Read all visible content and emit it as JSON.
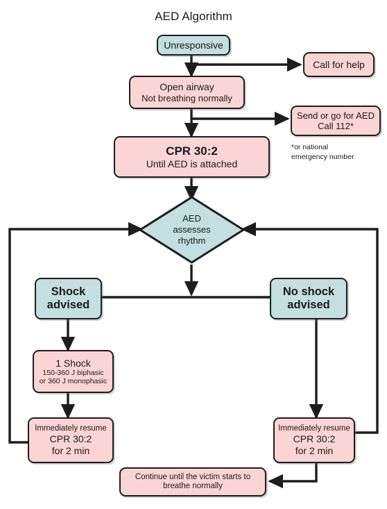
{
  "title": "AED Algorithm",
  "colors": {
    "pink": "#fbd4d5",
    "teal": "#c3dfdf",
    "stroke": "#1d1d1d",
    "background": "#ffffff",
    "text": "#1a1a1a"
  },
  "nodes": {
    "unresponsive": {
      "label": "Unresponsive",
      "shape": "rounded-rect",
      "fill": "teal"
    },
    "call_for_help": {
      "label": "Call for help",
      "shape": "rounded-rect",
      "fill": "pink"
    },
    "open_airway": {
      "line1": "Open airway",
      "line2": "Not breathing normally",
      "shape": "rounded-rect",
      "fill": "pink"
    },
    "send_for_aed": {
      "line1": "Send or go for AED",
      "line2": "Call 112*",
      "shape": "rounded-rect",
      "fill": "pink"
    },
    "cpr_initial": {
      "line1": "CPR 30:2",
      "line2": "Until AED is attached",
      "shape": "rounded-rect",
      "fill": "pink"
    },
    "aed_assesses": {
      "line1": "AED",
      "line2": "assesses",
      "line3": "rhythm",
      "shape": "diamond",
      "fill": "teal"
    },
    "shock_advised": {
      "line1": "Shock",
      "line2": "advised",
      "shape": "rounded-rect",
      "fill": "teal"
    },
    "no_shock_advised": {
      "line1": "No shock",
      "line2": "advised",
      "shape": "rounded-rect",
      "fill": "teal"
    },
    "one_shock": {
      "line1": "1 Shock",
      "line2": "150-360 J biphasic",
      "line3": "or 360 J monophasic",
      "shape": "rounded-rect",
      "fill": "pink"
    },
    "resume_cpr_left": {
      "line1": "Immediately resume",
      "line2": "CPR 30:2",
      "line3": "for 2 min",
      "shape": "rounded-rect",
      "fill": "pink"
    },
    "resume_cpr_right": {
      "line1": "Immediately resume",
      "line2": "CPR 30:2",
      "line3": "for 2 min",
      "shape": "rounded-rect",
      "fill": "pink"
    },
    "continue_until": {
      "line1": "Continue until the victim starts to",
      "line2": "breathe normally",
      "shape": "rounded-rect",
      "fill": "pink"
    }
  },
  "footnote": {
    "line1": "*or national",
    "line2": "emergency number"
  },
  "edges": [
    {
      "from": "unresponsive",
      "to": "open_airway",
      "arrow": true
    },
    {
      "from": "unresponsive",
      "to": "call_for_help",
      "arrow": true
    },
    {
      "from": "open_airway",
      "to": "cpr_initial",
      "arrow": true
    },
    {
      "from": "open_airway",
      "to": "send_for_aed",
      "arrow": true
    },
    {
      "from": "cpr_initial",
      "to": "aed_assesses",
      "arrow": true
    },
    {
      "from": "aed_assesses",
      "to": "shock_advised",
      "arrow": true
    },
    {
      "from": "aed_assesses",
      "to": "no_shock_advised",
      "arrow": true
    },
    {
      "from": "shock_advised",
      "to": "one_shock",
      "arrow": true
    },
    {
      "from": "one_shock",
      "to": "resume_cpr_left",
      "arrow": true
    },
    {
      "from": "no_shock_advised",
      "to": "resume_cpr_right",
      "arrow": true
    },
    {
      "from": "resume_cpr_left",
      "to": "aed_assesses",
      "arrow": true,
      "style": "loop-left"
    },
    {
      "from": "resume_cpr_right",
      "to": "aed_assesses",
      "arrow": true,
      "style": "loop-right"
    },
    {
      "from": "resume_cpr_right",
      "to": "continue_until",
      "arrow": true
    }
  ]
}
